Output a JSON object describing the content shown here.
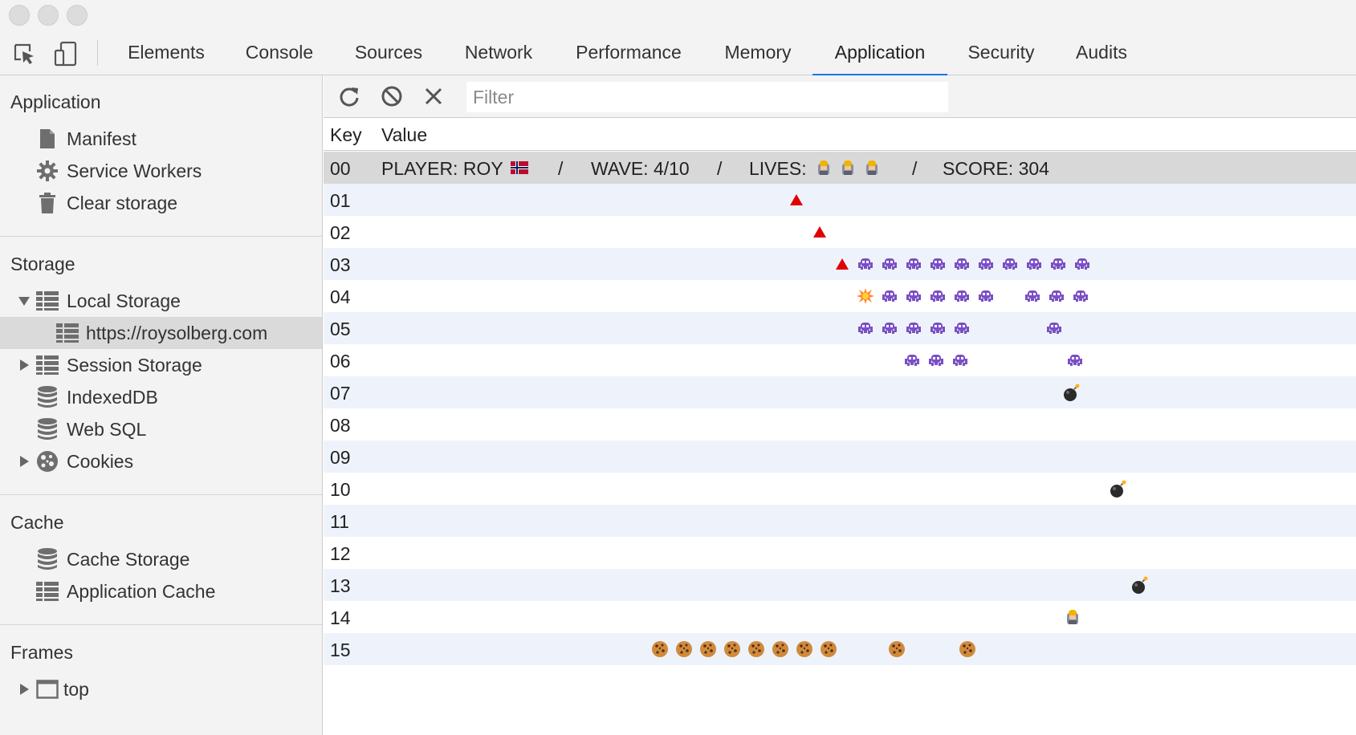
{
  "devtools": {
    "tabs": [
      "Elements",
      "Console",
      "Sources",
      "Network",
      "Performance",
      "Memory",
      "Application",
      "Security",
      "Audits"
    ],
    "active_tab": "Application"
  },
  "sidebar": {
    "application": {
      "title": "Application",
      "items": [
        "Manifest",
        "Service Workers",
        "Clear storage"
      ]
    },
    "storage": {
      "title": "Storage",
      "local_storage": "Local Storage",
      "local_origin": "https://roysolberg.com",
      "session_storage": "Session Storage",
      "indexeddb": "IndexedDB",
      "websql": "Web SQL",
      "cookies": "Cookies"
    },
    "cache": {
      "title": "Cache",
      "items": [
        "Cache Storage",
        "Application Cache"
      ]
    },
    "frames": {
      "title": "Frames",
      "top": "top"
    }
  },
  "filter": {
    "placeholder": "Filter",
    "value": ""
  },
  "table": {
    "headers": {
      "key": "Key",
      "value": "Value"
    },
    "status_row": {
      "key": "00",
      "player": "PLAYER: ROY",
      "sep1": "/",
      "wave": "WAVE: 4/10",
      "sep2": "/",
      "lives": "LIVES:",
      "sep3": "/",
      "score": "SCORE: 304"
    },
    "keys": [
      "01",
      "02",
      "03",
      "04",
      "05",
      "06",
      "07",
      "08",
      "09",
      "10",
      "11",
      "12",
      "13",
      "14",
      "15"
    ]
  },
  "game": {
    "lives_count": 3,
    "sprite_types": {
      "shot": "red-triangle-icon",
      "invader": "alien-monster-icon",
      "explosion": "explosion-icon",
      "bomb": "bomb-icon",
      "player": "player-ship-icon",
      "shield": "cookie-icon"
    }
  },
  "colors": {
    "accent": "#1a73e8",
    "row_alt": "#eef3fb",
    "row_selected": "#d8d8d8",
    "sidebar_bg": "#f3f3f3",
    "invader": "#7b4fc4",
    "shot": "#e00000"
  }
}
